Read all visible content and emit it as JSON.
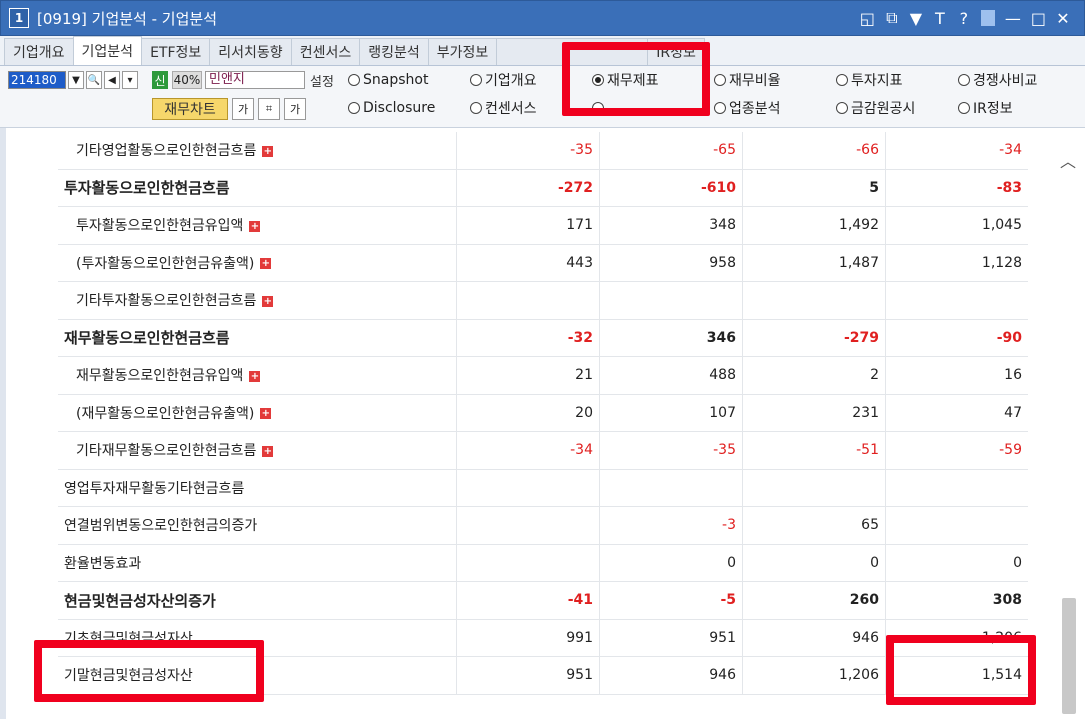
{
  "window": {
    "number": "1",
    "title": "[0919] 기업분석 - 기업분석",
    "tools": [
      "◱",
      "⧉",
      "▼",
      "T",
      "?",
      "—",
      "□",
      "✕"
    ]
  },
  "tabs": [
    {
      "label": "기업개요",
      "active": false
    },
    {
      "label": "기업분석",
      "active": true
    },
    {
      "label": "ETF정보",
      "active": false
    },
    {
      "label": "리서치동향",
      "active": false
    },
    {
      "label": "컨센서스",
      "active": false
    },
    {
      "label": "랭킹분석",
      "active": false
    },
    {
      "label": "부가정보",
      "active": false
    },
    {
      "label": "",
      "active": false
    },
    {
      "label": "IR정보",
      "active": false
    }
  ],
  "toolbar": {
    "stock_code": "214180",
    "new_badge": "신",
    "percent": "40%",
    "company_name": "민앤지",
    "setting_label": "설정",
    "chart_button": "재무차트",
    "font_a": "가",
    "font_b": "가"
  },
  "radios": [
    {
      "label": "Snapshot",
      "selected": false
    },
    {
      "label": "기업개요",
      "selected": false
    },
    {
      "label": "재무제표",
      "selected": true
    },
    {
      "label": "재무비율",
      "selected": false
    },
    {
      "label": "투자지표",
      "selected": false
    },
    {
      "label": "경쟁사비교",
      "selected": false
    },
    {
      "label": "Disclosure",
      "selected": false
    },
    {
      "label": "컨센서스",
      "selected": false
    },
    {
      "label": "",
      "selected": false
    },
    {
      "label": "업종분석",
      "selected": false
    },
    {
      "label": "금감원공시",
      "selected": false
    },
    {
      "label": "IR정보",
      "selected": false
    }
  ],
  "rows": [
    {
      "label": "기타영업활동으로인한현금흐름",
      "type": "sub",
      "plus": true,
      "values": [
        "-35",
        "-65",
        "-66",
        "-34"
      ]
    },
    {
      "label": "투자활동으로인한현금흐름",
      "type": "bold",
      "plus": false,
      "values": [
        "-272",
        "-610",
        "5",
        "-83"
      ]
    },
    {
      "label": "투자활동으로인한현금유입액",
      "type": "sub",
      "plus": true,
      "values": [
        "171",
        "348",
        "1,492",
        "1,045"
      ]
    },
    {
      "label": "(투자활동으로인한현금유출액)",
      "type": "sub",
      "plus": true,
      "values": [
        "443",
        "958",
        "1,487",
        "1,128"
      ]
    },
    {
      "label": "기타투자활동으로인한현금흐름",
      "type": "sub",
      "plus": true,
      "values": [
        "",
        "",
        "",
        ""
      ]
    },
    {
      "label": "재무활동으로인한현금흐름",
      "type": "bold",
      "plus": false,
      "values": [
        "-32",
        "346",
        "-279",
        "-90"
      ]
    },
    {
      "label": "재무활동으로인한현금유입액",
      "type": "sub",
      "plus": true,
      "values": [
        "21",
        "488",
        "2",
        "16"
      ]
    },
    {
      "label": "(재무활동으로인한현금유출액)",
      "type": "sub",
      "plus": true,
      "values": [
        "20",
        "107",
        "231",
        "47"
      ]
    },
    {
      "label": "기타재무활동으로인한현금흐름",
      "type": "sub",
      "plus": true,
      "values": [
        "-34",
        "-35",
        "-51",
        "-59"
      ]
    },
    {
      "label": "영업투자재무활동기타현금흐름",
      "type": "plain",
      "plus": false,
      "values": [
        "",
        "",
        "",
        ""
      ]
    },
    {
      "label": "연결범위변동으로인한현금의증가",
      "type": "plain",
      "plus": false,
      "values": [
        "",
        "-3",
        "65",
        ""
      ]
    },
    {
      "label": "환율변동효과",
      "type": "plain",
      "plus": false,
      "values": [
        "",
        "0",
        "0",
        "0"
      ]
    },
    {
      "label": "현금및현금성자산의증가",
      "type": "bold",
      "plus": false,
      "values": [
        "-41",
        "-5",
        "260",
        "308"
      ]
    },
    {
      "label": "기초현금및현금성자산",
      "type": "plain",
      "plus": false,
      "values": [
        "991",
        "951",
        "946",
        "1,206"
      ]
    },
    {
      "label": "기말현금및현금성자산",
      "type": "plain",
      "plus": false,
      "values": [
        "951",
        "946",
        "1,206",
        "1,514"
      ]
    }
  ],
  "colors": {
    "negative": "#e02020",
    "highlight": "#f0001e",
    "titlebar": "#3a6fb8"
  }
}
